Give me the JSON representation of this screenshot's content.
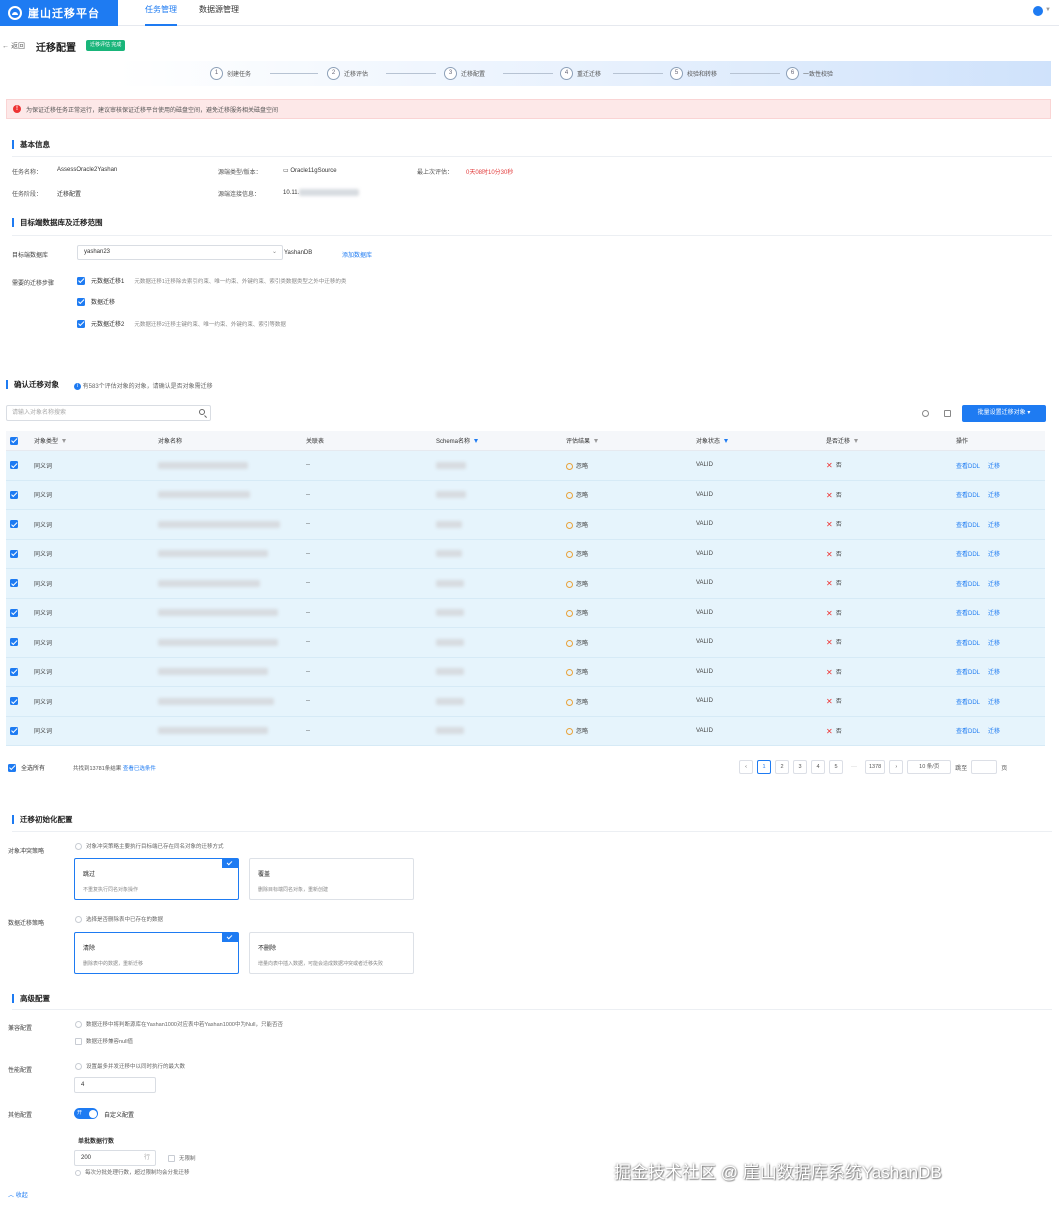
{
  "app": {
    "name": "崖山迁移平台"
  },
  "topnav": {
    "items": [
      "任务管理",
      "数据源管理"
    ],
    "active": 0
  },
  "header": {
    "back_label": "返回",
    "title": "迁移配置",
    "badge": "迁移评估 完成"
  },
  "steps": [
    {
      "num": "1",
      "label": "创建任务"
    },
    {
      "num": "2",
      "label": "迁移评估"
    },
    {
      "num": "3",
      "label": "迁移配置"
    },
    {
      "num": "4",
      "label": "重迁迁移"
    },
    {
      "num": "5",
      "label": "校验和转移"
    },
    {
      "num": "6",
      "label": "一致性校验"
    }
  ],
  "alert": {
    "text": "为保证迁移任务正常运行，建议审核保证迁移平台使用的磁盘空间，避免迁移服务相关磁盘空间"
  },
  "basic": {
    "title": "基本信息",
    "task_name_label": "任务名称：",
    "task_name": "AssessOracle2Yashan",
    "source_label": "源端类型/版本：",
    "source_value": "Oracle11gSource",
    "last_eval_label": "最上次评估：",
    "last_eval_value": "0天08时10分30秒",
    "stage_label": "任务阶段：",
    "stage_value": "迁移配置",
    "conn_label": "源端连接信息：",
    "conn_value": "10.11."
  },
  "target": {
    "title": "目标端数据库及迁移范围",
    "db_label": "目标端数据库",
    "db_value": "yashan23",
    "db_type": "YashanDB",
    "add_db_link": "添加数据库",
    "steps_label": "需要的迁移步骤",
    "checks": [
      {
        "label": "元数据迁移1",
        "desc": "元数据迁移1迁移除去索引约束、唯一约束、外键约束、索引类数据类型之外中迁移的类"
      },
      {
        "label": "数据迁移",
        "desc": ""
      },
      {
        "label": "元数据迁移2",
        "desc": "元数据迁移2迁移主键约束、唯一约束、外键约束、索引等数据"
      }
    ]
  },
  "objects": {
    "title": "确认迁移对象",
    "info": "有583个评估对象的对象，请确认是否对象需迁移",
    "search_placeholder": "请输入对象名称搜索",
    "batch_button": "批量设置迁移对象 ▾",
    "columns": [
      "对象类型",
      "对象名称",
      "关联表",
      "Schema名称",
      "评估结果",
      "对象状态",
      "是否迁移",
      "操作"
    ],
    "rows": [
      {
        "type": "同义词",
        "assoc": "--",
        "eval": "忽略",
        "state": "VALID",
        "migrate": "否",
        "op1": "查看DDL",
        "op2": "迁移"
      },
      {
        "type": "同义词",
        "assoc": "--",
        "eval": "忽略",
        "state": "VALID",
        "migrate": "否",
        "op1": "查看DDL",
        "op2": "迁移"
      },
      {
        "type": "同义词",
        "assoc": "--",
        "eval": "忽略",
        "state": "VALID",
        "migrate": "否",
        "op1": "查看DDL",
        "op2": "迁移"
      },
      {
        "type": "同义词",
        "assoc": "--",
        "eval": "忽略",
        "state": "VALID",
        "migrate": "否",
        "op1": "查看DDL",
        "op2": "迁移"
      },
      {
        "type": "同义词",
        "assoc": "--",
        "eval": "忽略",
        "state": "VALID",
        "migrate": "否",
        "op1": "查看DDL",
        "op2": "迁移"
      },
      {
        "type": "同义词",
        "assoc": "--",
        "eval": "忽略",
        "state": "VALID",
        "migrate": "否",
        "op1": "查看DDL",
        "op2": "迁移"
      },
      {
        "type": "同义词",
        "assoc": "--",
        "eval": "忽略",
        "state": "VALID",
        "migrate": "否",
        "op1": "查看DDL",
        "op2": "迁移"
      },
      {
        "type": "同义词",
        "assoc": "--",
        "eval": "忽略",
        "state": "VALID",
        "migrate": "否",
        "op1": "查看DDL",
        "op2": "迁移"
      },
      {
        "type": "同义词",
        "assoc": "--",
        "eval": "忽略",
        "state": "VALID",
        "migrate": "否",
        "op1": "查看DDL",
        "op2": "迁移"
      },
      {
        "type": "同义词",
        "assoc": "--",
        "eval": "忽略",
        "state": "VALID",
        "migrate": "否",
        "op1": "查看DDL",
        "op2": "迁移"
      }
    ],
    "select_all_label": "全选所有",
    "selected_count": "共找到13781条结果",
    "view_selected_link": "查看已选条件",
    "pages": [
      "1",
      "2",
      "3",
      "4",
      "5",
      "1378"
    ],
    "page_size": "10 条/页",
    "goto_label": "跳至",
    "goto_suffix": "页"
  },
  "init": {
    "title": "迁移初始化配置",
    "conflict_label": "对象冲突策略",
    "conflict_option": "对象冲突策略主要执行目标端已存在同名对象的迁移方式",
    "cards1": [
      {
        "title": "跳过",
        "desc": "不重复执行同名对象操作"
      },
      {
        "title": "覆盖",
        "desc": "删除目标端同名对象，重新创建"
      }
    ],
    "data_label": "数据迁移策略",
    "data_option": "选择是否删除表中已存在的数据",
    "cards2": [
      {
        "title": "清除",
        "desc": "删除表中的数据，重新迁移"
      },
      {
        "title": "不删除",
        "desc": "增量向表中插入数据，可能会造成数据冲突或者迁移失败"
      }
    ]
  },
  "advanced": {
    "title": "高级配置",
    "compat_label": "兼容配置",
    "compat_option": "数据迁移中将判断源库在Yashan1000对应表中若Yashan1000中为Null，只能否否",
    "compat_check": "数据迁移兼容null值",
    "perf_label": "性能配置",
    "perf_option": "设置最多并发迁移中以同时执行的最大数",
    "perf_value": "4",
    "other_label": "其他配置",
    "toggle_text": "开",
    "toggle_label": "自定义配置",
    "batch_label": "单批数据行数",
    "batch_value": "200",
    "batch_unit": "行",
    "unlimited_label": "无限制",
    "batch_hint": "每次分批处理行数，超过限制均会分批迁移",
    "collapse_label": "收起"
  },
  "watermark": "掘金技术社区 @ 崖山数据库系统YashanDB"
}
